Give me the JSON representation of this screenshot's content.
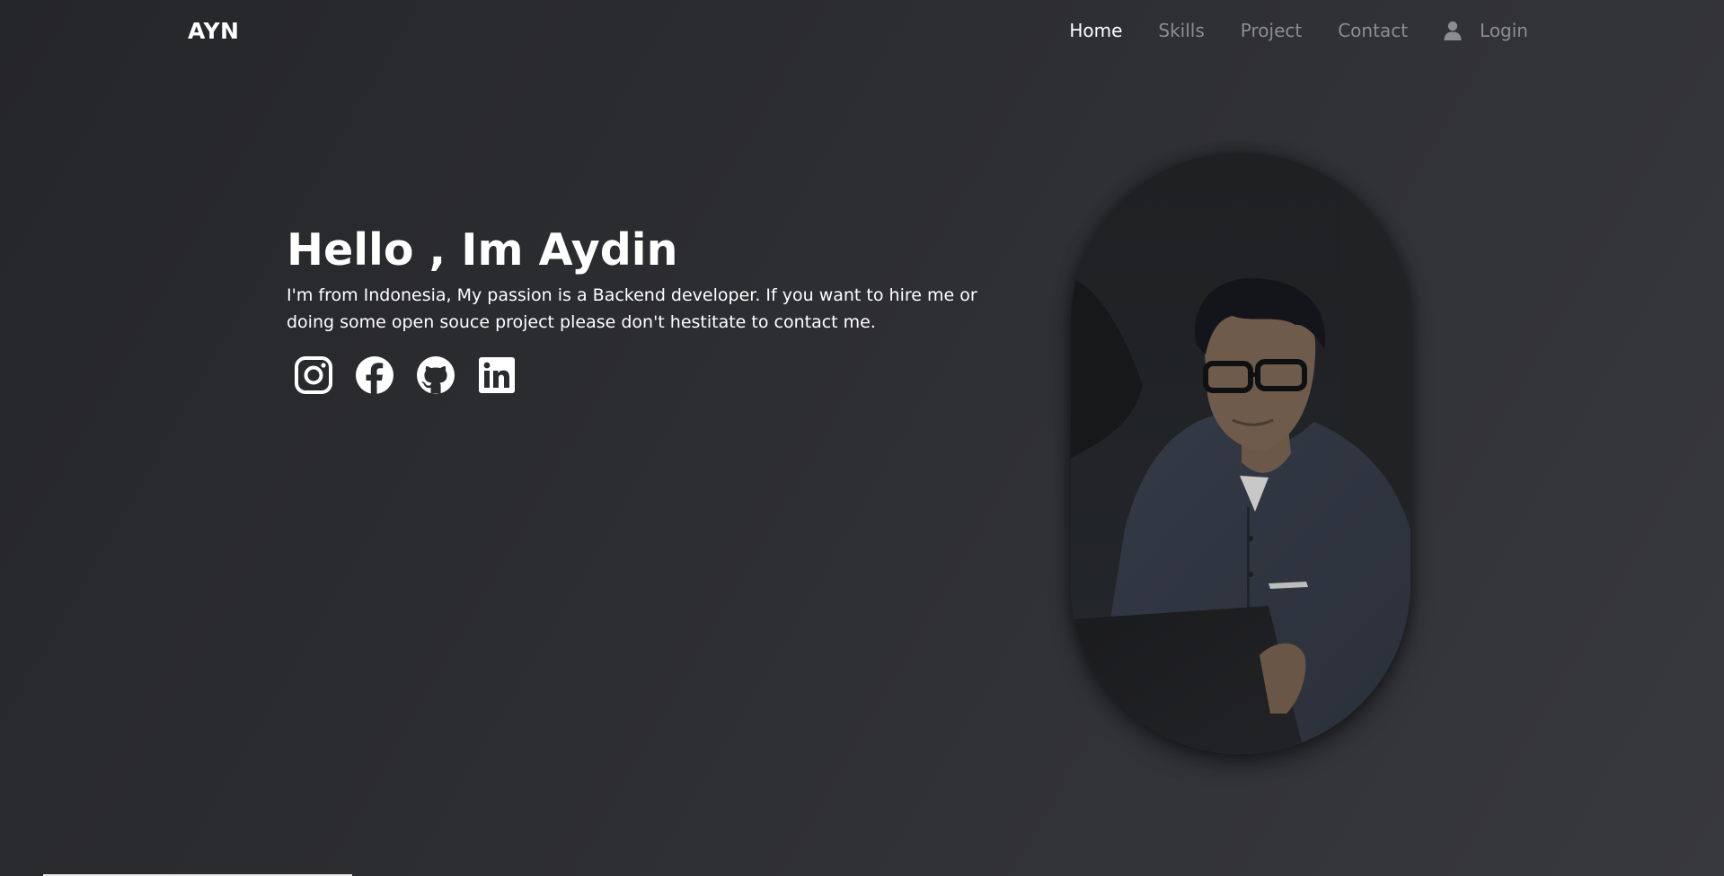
{
  "navbar": {
    "brand": "AYN",
    "links": [
      {
        "label": "Home",
        "active": true
      },
      {
        "label": "Skills",
        "active": false
      },
      {
        "label": "Project",
        "active": false
      },
      {
        "label": "Contact",
        "active": false
      }
    ],
    "login": {
      "label": "Login",
      "icon": "user-icon"
    }
  },
  "hero": {
    "title": "Hello , Im Aydin",
    "description": "I'm from Indonesia, My passion is a Backend developer. If you want to hire me or doing some open souce project please don't hestitate to contact me.",
    "social_icons": [
      "instagram-icon",
      "facebook-icon",
      "github-icon",
      "linkedin-icon"
    ]
  },
  "colors": {
    "background_start": "#25262a",
    "background_end": "#38393d",
    "text": "#ffffff",
    "nav_inactive": "#8b8d90"
  }
}
